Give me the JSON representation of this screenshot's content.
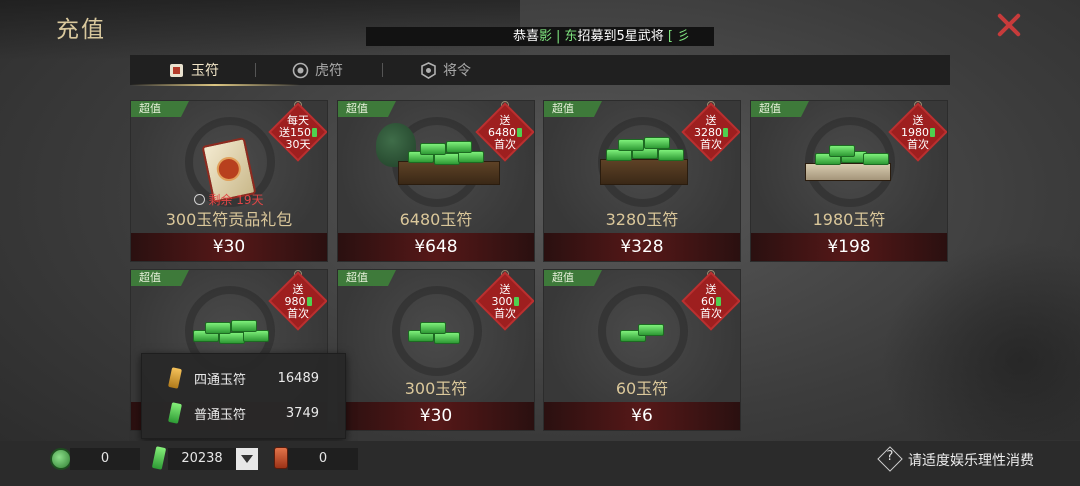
{
  "window": {
    "title": "充值",
    "close_icon": "close-x-icon",
    "accent": "#c73b3b"
  },
  "marquee": {
    "prefix": "恭喜",
    "name_a": "影",
    "sep": "|",
    "name_b": "东",
    "message": "招募到5星武将",
    "tail": "[ 彡"
  },
  "tabs": [
    {
      "label": "玉符",
      "icon": "jade-seal-icon",
      "active": true
    },
    {
      "label": "虎符",
      "icon": "tiger-token-icon",
      "active": false
    },
    {
      "label": "将令",
      "icon": "general-order-icon",
      "active": false
    }
  ],
  "cards": [
    {
      "badge": "超值",
      "name": "300玉符贡品礼包",
      "price": "¥30",
      "bonus_lines": [
        "每天",
        "送150",
        "30天"
      ],
      "remaining": "剩余 19天"
    },
    {
      "badge": "超值",
      "name": "6480玉符",
      "price": "¥648",
      "bonus_lines": [
        "送",
        "6480",
        "首次"
      ]
    },
    {
      "badge": "超值",
      "name": "3280玉符",
      "price": "¥328",
      "bonus_lines": [
        "送",
        "3280",
        "首次"
      ]
    },
    {
      "badge": "超值",
      "name": "1980玉符",
      "price": "¥198",
      "bonus_lines": [
        "送",
        "1980",
        "首次"
      ]
    },
    {
      "badge": "超值",
      "name": "",
      "price": "",
      "bonus_lines": [
        "送",
        "980",
        "首次"
      ]
    },
    {
      "badge": "超值",
      "name": "300玉符",
      "price": "¥30",
      "bonus_lines": [
        "送",
        "300",
        "首次"
      ]
    },
    {
      "badge": "超值",
      "name": "60玉符",
      "price": "¥6",
      "bonus_lines": [
        "送",
        "60",
        "首次"
      ]
    }
  ],
  "tooltip": {
    "rows": [
      {
        "icon": "gold-jade-icon",
        "label": "四通玉符",
        "value": "16489"
      },
      {
        "icon": "green-jade-icon",
        "label": "普通玉符",
        "value": "3749"
      }
    ]
  },
  "bottom": {
    "coin_value": "0",
    "jade_value": "20238",
    "token_value": "0",
    "notice": "请适度娱乐理性消费"
  },
  "colors": {
    "super_badge": "#3e7a3a",
    "bonus_diamond": "#9e1f1f",
    "price_bar": "#561818",
    "gold_text": "#dac79a"
  }
}
